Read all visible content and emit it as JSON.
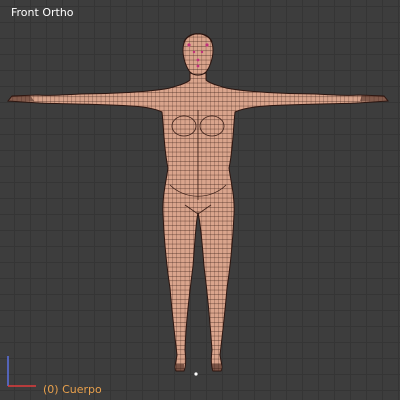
{
  "viewport": {
    "view_name": "Front Ortho",
    "object_name": "(0) Cuerpo",
    "accent_object_color": "#e8a04c",
    "mesh_fill_color": "#d9a48c",
    "mesh_wire_color": "#3a1e16",
    "selected_vertex_color": "#c0307a",
    "axis_x_color": "#e03c3c",
    "axis_z_color": "#5a6fd8"
  }
}
